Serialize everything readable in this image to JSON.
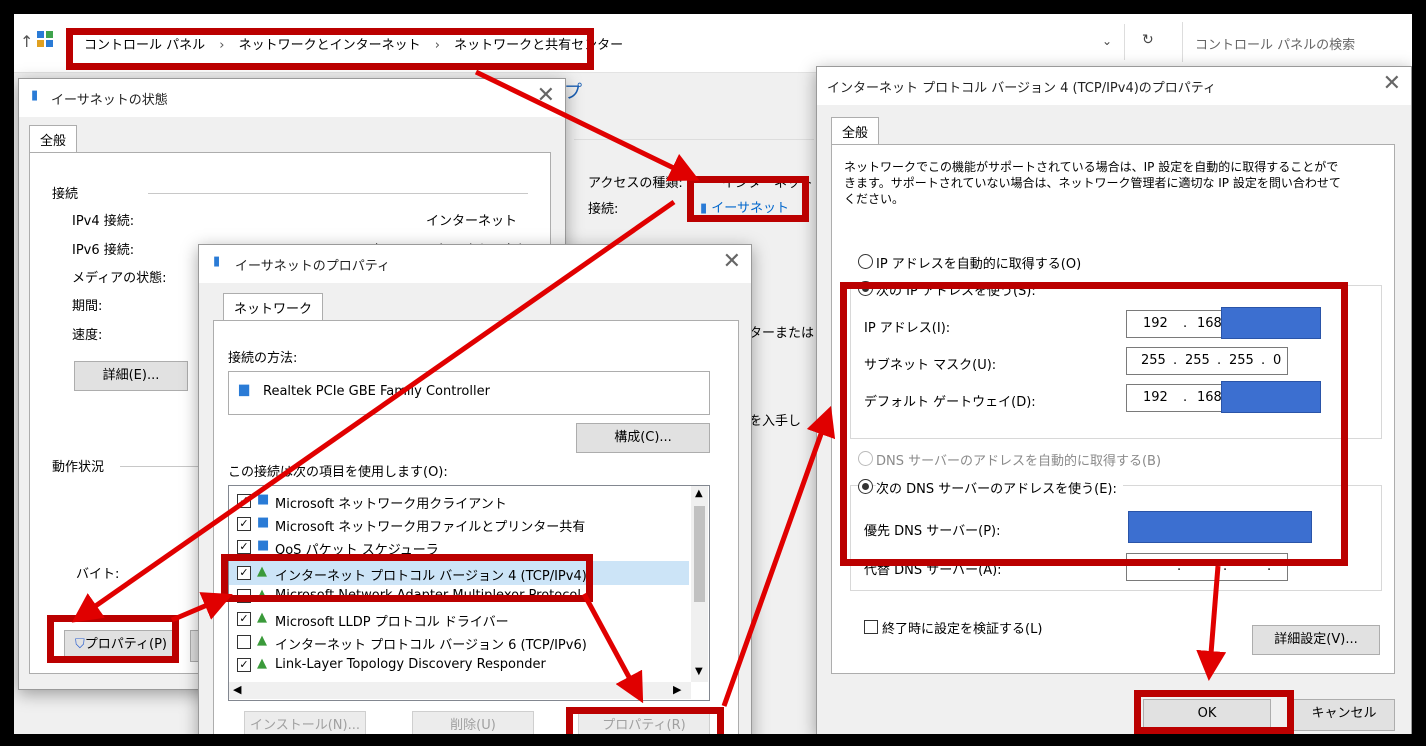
{
  "explorer": {
    "breadcrumb": [
      "コントロール パネル",
      "ネットワークとインターネット",
      "ネットワークと共有センター"
    ],
    "breadcrumb_sep": "›",
    "search_placeholder": "コントロール パネルの検索",
    "back_fragment": "プ",
    "access_type_label": "アクセスの種類:",
    "access_type_value": "インターネット",
    "connection_label": "接続:",
    "connection_link": "イーサネット",
    "fragment_router": "ーターまたは",
    "fragment_info": "報を入手し"
  },
  "status_dialog": {
    "title": "イーサネットの状態",
    "tab": "全般",
    "connection_group": "接続",
    "rows": [
      {
        "label": "IPv4 接続:",
        "value": "インターネット"
      },
      {
        "label": "IPv6 接続:",
        "value": "ネットワーク アクセスなし"
      },
      {
        "label": "メディアの状態:",
        "value": ""
      },
      {
        "label": "期間:",
        "value": ""
      },
      {
        "label": "速度:",
        "value": ""
      }
    ],
    "details_button": "詳細(E)...",
    "activity_group": "動作状況",
    "bytes_label": "バイト:",
    "properties_button": "プロパティ(P)"
  },
  "eth_props": {
    "title": "イーサネットのプロパティ",
    "tab": "ネットワーク",
    "connect_using_label": "接続の方法:",
    "adapter_name": "Realtek PCIe GBE Family Controller",
    "configure_button": "構成(C)...",
    "items_label": "この接続は次の項目を使用します(O):",
    "items": [
      {
        "label": "Microsoft ネットワーク用クライアント",
        "checked": true
      },
      {
        "label": "Microsoft ネットワーク用ファイルとプリンター共有",
        "checked": true
      },
      {
        "label": "QoS パケット スケジューラ",
        "checked": true
      },
      {
        "label": "インターネット プロトコル バージョン 4 (TCP/IPv4)",
        "checked": true
      },
      {
        "label": "Microsoft Network Adapter Multiplexor Protocol",
        "checked": false
      },
      {
        "label": "Microsoft LLDP プロトコル ドライバー",
        "checked": true
      },
      {
        "label": "インターネット プロトコル バージョン 6 (TCP/IPv6)",
        "checked": false
      },
      {
        "label": "Link-Layer Topology Discovery Responder",
        "checked": true
      }
    ],
    "install_button": "インストール(N)...",
    "uninstall_button": "削除(U)",
    "properties_button": "プロパティ(R)"
  },
  "ipv4_dialog": {
    "title": "インターネット プロトコル バージョン 4 (TCP/IPv4)のプロパティ",
    "tab": "全般",
    "description": [
      "ネットワークでこの機能がサポートされている場合は、IP 設定を自動的に取得することがで",
      "きます。サポートされていない場合は、ネットワーク管理者に適切な IP 設定を問い合わせて",
      "ください。"
    ],
    "auto_ip_label": "IP アドレスを自動的に取得する(O)",
    "use_ip_label": "次の IP アドレスを使う(S):",
    "ip_address_label": "IP アドレス(I):",
    "ip_address_value": [
      "192",
      "168"
    ],
    "subnet_label": "サブネット マスク(U):",
    "subnet_value": [
      "255",
      "255",
      "255",
      "0"
    ],
    "gateway_label": "デフォルト ゲートウェイ(D):",
    "gateway_value": [
      "192",
      "168"
    ],
    "auto_dns_label": "DNS サーバーのアドレスを自動的に取得する(B)",
    "use_dns_label": "次の DNS サーバーのアドレスを使う(E):",
    "preferred_dns_label": "優先 DNS サーバー(P):",
    "alternate_dns_label": "代替 DNS サーバー(A):",
    "validate_label": "終了時に設定を検証する(L)",
    "advanced_button": "詳細設定(V)...",
    "ok_button": "OK",
    "cancel_button": "キャンセル"
  },
  "colors": {
    "annotation_red": "#bb0000",
    "redaction_blue": "#3c6fd0",
    "link_blue": "#0066cc"
  }
}
